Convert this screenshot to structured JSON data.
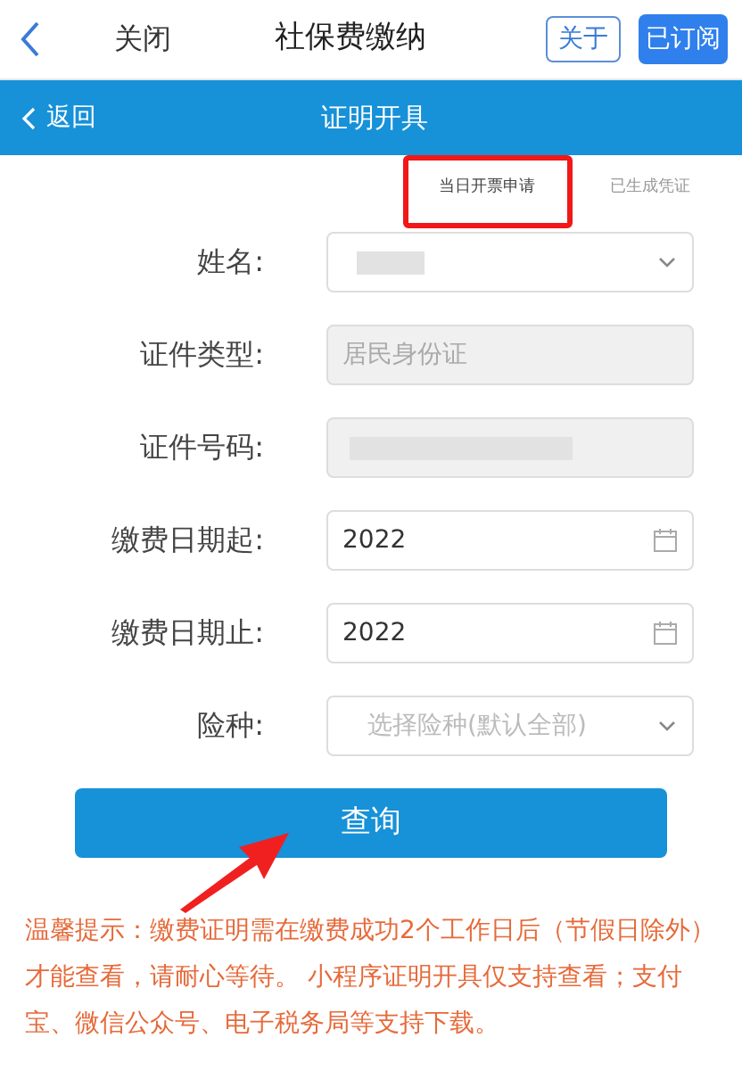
{
  "top_bar": {
    "close": "关闭",
    "title": "社保费缴纳",
    "about": "关于",
    "subscribed": "已订阅"
  },
  "nav_bar": {
    "back": "返回",
    "title": "证明开具"
  },
  "tabs": [
    {
      "label": "当日开票申请",
      "selected": true
    },
    {
      "label": "已生成凭证",
      "selected": false
    }
  ],
  "fields": [
    {
      "label": "姓名:",
      "kind": "select",
      "redacted": true,
      "disabled": false
    },
    {
      "label": "证件类型:",
      "kind": "text",
      "value": "居民身份证",
      "disabled": true
    },
    {
      "label": "证件号码:",
      "kind": "text",
      "redacted": true,
      "disabled": true
    },
    {
      "label": "缴费日期起:",
      "kind": "date",
      "value": "2022",
      "disabled": false
    },
    {
      "label": "缴费日期止:",
      "kind": "date",
      "value": "2022",
      "disabled": false
    },
    {
      "label": "险种:",
      "kind": "select",
      "placeholder": "选择险种(默认全部)",
      "disabled": false
    }
  ],
  "query_button": "查询",
  "notice": "温馨提示：缴费证明需在缴费成功2个工作日后（节假日除外）才能查看，请耐心等待。 小程序证明开具仅支持查看；支付宝、微信公众号、电子税务局等支持下载。"
}
